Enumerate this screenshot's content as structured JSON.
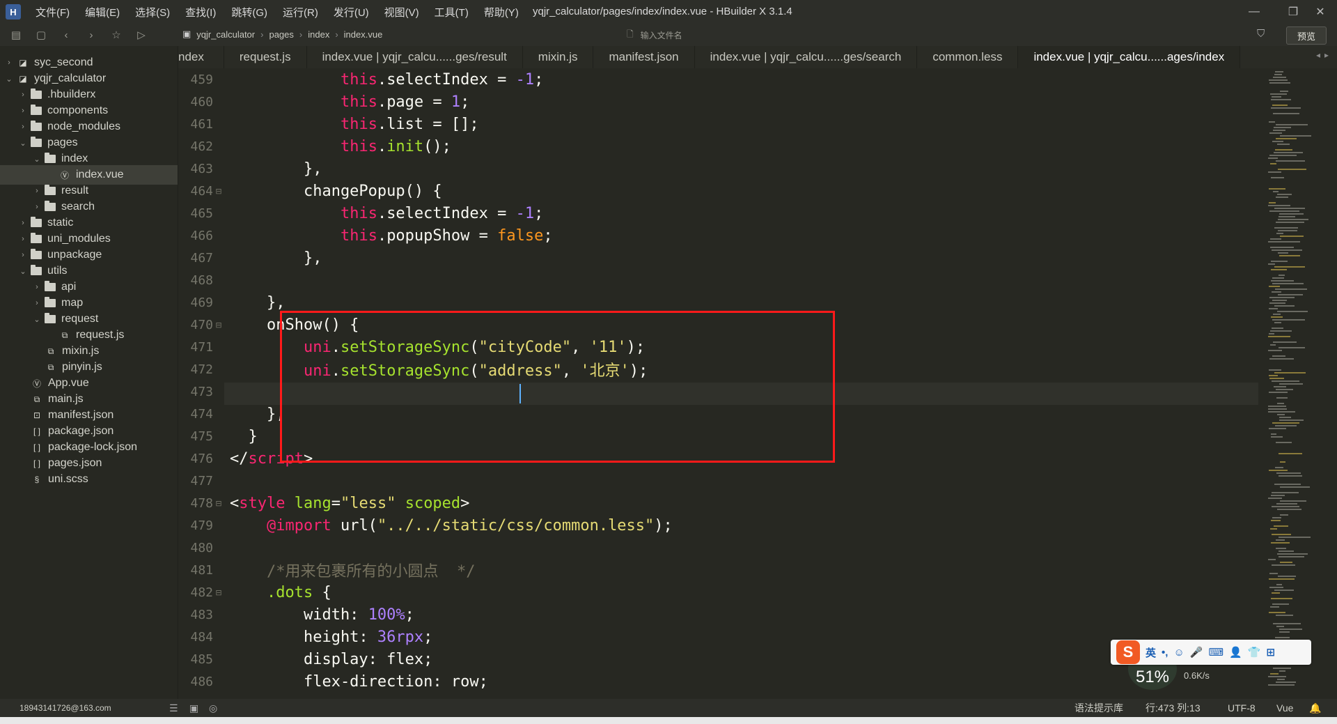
{
  "titlebar": {
    "logo": "H",
    "menu": [
      "文件(F)",
      "编辑(E)",
      "选择(S)",
      "查找(I)",
      "跳转(G)",
      "运行(R)",
      "发行(U)",
      "视图(V)",
      "工具(T)",
      "帮助(Y)"
    ],
    "title": "yqjr_calculator/pages/index/index.vue - HBuilder X 3.1.4",
    "minimize": "—",
    "maximize": "❐",
    "close": "✕"
  },
  "toolbar": {
    "breadcrumb": [
      "yqjr_calculator",
      "pages",
      "index",
      "index.vue"
    ],
    "file_search_placeholder": "输入文件名",
    "preview_label": "预览"
  },
  "sidebar": {
    "items": [
      {
        "label": "syc_second",
        "depth": 0,
        "chev": "›",
        "type": "project"
      },
      {
        "label": "yqjr_calculator",
        "depth": 0,
        "chev": "⌄",
        "type": "project"
      },
      {
        "label": ".hbuilderx",
        "depth": 1,
        "chev": "›",
        "type": "folder"
      },
      {
        "label": "components",
        "depth": 1,
        "chev": "›",
        "type": "folder"
      },
      {
        "label": "node_modules",
        "depth": 1,
        "chev": "›",
        "type": "folder"
      },
      {
        "label": "pages",
        "depth": 1,
        "chev": "⌄",
        "type": "folder"
      },
      {
        "label": "index",
        "depth": 2,
        "chev": "⌄",
        "type": "folder"
      },
      {
        "label": "index.vue",
        "depth": 3,
        "chev": "",
        "type": "vue"
      },
      {
        "label": "result",
        "depth": 2,
        "chev": "›",
        "type": "folder"
      },
      {
        "label": "search",
        "depth": 2,
        "chev": "›",
        "type": "folder"
      },
      {
        "label": "static",
        "depth": 1,
        "chev": "›",
        "type": "folder"
      },
      {
        "label": "uni_modules",
        "depth": 1,
        "chev": "›",
        "type": "folder"
      },
      {
        "label": "unpackage",
        "depth": 1,
        "chev": "›",
        "type": "folder"
      },
      {
        "label": "utils",
        "depth": 1,
        "chev": "⌄",
        "type": "folder"
      },
      {
        "label": "api",
        "depth": 2,
        "chev": "›",
        "type": "folder"
      },
      {
        "label": "map",
        "depth": 2,
        "chev": "›",
        "type": "folder"
      },
      {
        "label": "request",
        "depth": 2,
        "chev": "⌄",
        "type": "folder"
      },
      {
        "label": "request.js",
        "depth": 3,
        "chev": "",
        "type": "js"
      },
      {
        "label": "mixin.js",
        "depth": 2,
        "chev": "",
        "type": "js"
      },
      {
        "label": "pinyin.js",
        "depth": 2,
        "chev": "",
        "type": "js"
      },
      {
        "label": "App.vue",
        "depth": 1,
        "chev": "",
        "type": "vue"
      },
      {
        "label": "main.js",
        "depth": 1,
        "chev": "",
        "type": "js"
      },
      {
        "label": "manifest.json",
        "depth": 1,
        "chev": "",
        "type": "manifest"
      },
      {
        "label": "package.json",
        "depth": 1,
        "chev": "",
        "type": "json"
      },
      {
        "label": "package-lock.json",
        "depth": 1,
        "chev": "",
        "type": "json"
      },
      {
        "label": "pages.json",
        "depth": 1,
        "chev": "",
        "type": "json"
      },
      {
        "label": "uni.scss",
        "depth": 1,
        "chev": "",
        "type": "scss"
      }
    ],
    "selected_index": 7
  },
  "tabs": [
    {
      "label": "ndex",
      "active": false
    },
    {
      "label": "request.js",
      "active": false
    },
    {
      "label": "index.vue | yqjr_calcu......ges/result",
      "active": false
    },
    {
      "label": "mixin.js",
      "active": false
    },
    {
      "label": "manifest.json",
      "active": false
    },
    {
      "label": "index.vue | yqjr_calcu......ges/search",
      "active": false
    },
    {
      "label": "common.less",
      "active": false
    },
    {
      "label": "index.vue | yqjr_calcu......ages/index",
      "active": true
    }
  ],
  "editor": {
    "current_line": 473,
    "lines": [
      {
        "n": "459",
        "fold": "",
        "tokens": [
          [
            "",
            "            "
          ],
          [
            "k",
            "this"
          ],
          [
            "",
            "."
          ],
          [
            "",
            "selectIndex = "
          ],
          [
            "n",
            "-1"
          ],
          [
            "",
            ";"
          ]
        ]
      },
      {
        "n": "460",
        "fold": "",
        "tokens": [
          [
            "",
            "            "
          ],
          [
            "k",
            "this"
          ],
          [
            "",
            "."
          ],
          [
            "",
            "page = "
          ],
          [
            "n",
            "1"
          ],
          [
            "",
            ";"
          ]
        ]
      },
      {
        "n": "461",
        "fold": "",
        "tokens": [
          [
            "",
            "            "
          ],
          [
            "k",
            "this"
          ],
          [
            "",
            "."
          ],
          [
            "",
            "list = [];"
          ]
        ]
      },
      {
        "n": "462",
        "fold": "",
        "tokens": [
          [
            "",
            "            "
          ],
          [
            "k",
            "this"
          ],
          [
            "",
            "."
          ],
          [
            "f",
            "init"
          ],
          [
            "",
            "();"
          ]
        ]
      },
      {
        "n": "463",
        "fold": "",
        "tokens": [
          [
            "",
            "        },"
          ]
        ]
      },
      {
        "n": "464",
        "fold": "⊟",
        "tokens": [
          [
            "",
            "        changePopup() {"
          ]
        ]
      },
      {
        "n": "465",
        "fold": "",
        "tokens": [
          [
            "",
            "            "
          ],
          [
            "k",
            "this"
          ],
          [
            "",
            "."
          ],
          [
            "",
            "selectIndex = "
          ],
          [
            "n",
            "-1"
          ],
          [
            "",
            ";"
          ]
        ]
      },
      {
        "n": "466",
        "fold": "",
        "tokens": [
          [
            "",
            "            "
          ],
          [
            "k",
            "this"
          ],
          [
            "",
            "."
          ],
          [
            "",
            "popupShow = "
          ],
          [
            "p",
            "false"
          ],
          [
            "",
            ";"
          ]
        ]
      },
      {
        "n": "467",
        "fold": "",
        "tokens": [
          [
            "",
            "        },"
          ]
        ]
      },
      {
        "n": "468",
        "fold": "",
        "tokens": [
          [
            "",
            ""
          ]
        ]
      },
      {
        "n": "469",
        "fold": "",
        "tokens": [
          [
            "",
            "    },"
          ]
        ]
      },
      {
        "n": "470",
        "fold": "⊟",
        "tokens": [
          [
            "",
            "    onShow() {"
          ]
        ]
      },
      {
        "n": "471",
        "fold": "",
        "tokens": [
          [
            "",
            "        "
          ],
          [
            "k",
            "uni"
          ],
          [
            "",
            "."
          ],
          [
            "f",
            "setStorageSync"
          ],
          [
            "",
            "("
          ],
          [
            "s",
            "\"cityCode\""
          ],
          [
            "",
            ", "
          ],
          [
            "s",
            "'11'"
          ],
          [
            "",
            ");"
          ]
        ]
      },
      {
        "n": "472",
        "fold": "",
        "tokens": [
          [
            "",
            "        "
          ],
          [
            "k",
            "uni"
          ],
          [
            "",
            "."
          ],
          [
            "f",
            "setStorageSync"
          ],
          [
            "",
            "("
          ],
          [
            "s",
            "\"address\""
          ],
          [
            "",
            ", "
          ],
          [
            "s",
            "'北京'"
          ],
          [
            "",
            ");"
          ]
        ]
      },
      {
        "n": "473",
        "fold": "",
        "tokens": [
          [
            "",
            ""
          ]
        ]
      },
      {
        "n": "474",
        "fold": "",
        "tokens": [
          [
            "",
            "    },"
          ]
        ]
      },
      {
        "n": "475",
        "fold": "",
        "tokens": [
          [
            "",
            "  }"
          ]
        ]
      },
      {
        "n": "476",
        "fold": "",
        "tokens": [
          [
            "",
            "</"
          ],
          [
            "t",
            "script"
          ],
          [
            "",
            ">"
          ]
        ]
      },
      {
        "n": "477",
        "fold": "",
        "tokens": [
          [
            "",
            ""
          ]
        ]
      },
      {
        "n": "478",
        "fold": "⊟",
        "tokens": [
          [
            "",
            "<"
          ],
          [
            "t",
            "style"
          ],
          [
            "a",
            " lang"
          ],
          [
            "",
            "="
          ],
          [
            "s",
            "\"less\""
          ],
          [
            "a",
            " scoped"
          ],
          [
            "",
            ">"
          ]
        ]
      },
      {
        "n": "479",
        "fold": "",
        "tokens": [
          [
            "",
            "    "
          ],
          [
            "k",
            "@import"
          ],
          [
            "",
            " url("
          ],
          [
            "s",
            "\"../../static/css/common.less\""
          ],
          [
            "",
            ");"
          ]
        ]
      },
      {
        "n": "480",
        "fold": "",
        "tokens": [
          [
            "",
            ""
          ]
        ]
      },
      {
        "n": "481",
        "fold": "",
        "tokens": [
          [
            "c",
            "    /*用来包裹所有的小圆点  */"
          ]
        ]
      },
      {
        "n": "482",
        "fold": "⊟",
        "tokens": [
          [
            "",
            "    "
          ],
          [
            "f",
            ".dots"
          ],
          [
            "",
            " {"
          ]
        ]
      },
      {
        "n": "483",
        "fold": "",
        "tokens": [
          [
            "",
            "        width: "
          ],
          [
            "n",
            "100%"
          ],
          [
            "",
            ";"
          ]
        ]
      },
      {
        "n": "484",
        "fold": "",
        "tokens": [
          [
            "",
            "        height: "
          ],
          [
            "n",
            "36rpx"
          ],
          [
            "",
            ";"
          ]
        ]
      },
      {
        "n": "485",
        "fold": "",
        "tokens": [
          [
            "",
            "        display: flex;"
          ]
        ]
      },
      {
        "n": "486",
        "fold": "",
        "tokens": [
          [
            "",
            "        flex-direction: row;"
          ]
        ]
      }
    ]
  },
  "ime": {
    "logo": "S",
    "mode": "英",
    "icons": [
      "•,",
      "☺",
      "🎤",
      "⌨",
      "👤",
      "👕",
      "⊞"
    ]
  },
  "network": {
    "percent": "51%",
    "speed": "0.6K/s"
  },
  "statusbar": {
    "user": "18943141726@163.com",
    "syntax_lib": "语法提示库",
    "position": "行:473 列:13",
    "encoding": "UTF-8",
    "language": "Vue"
  }
}
